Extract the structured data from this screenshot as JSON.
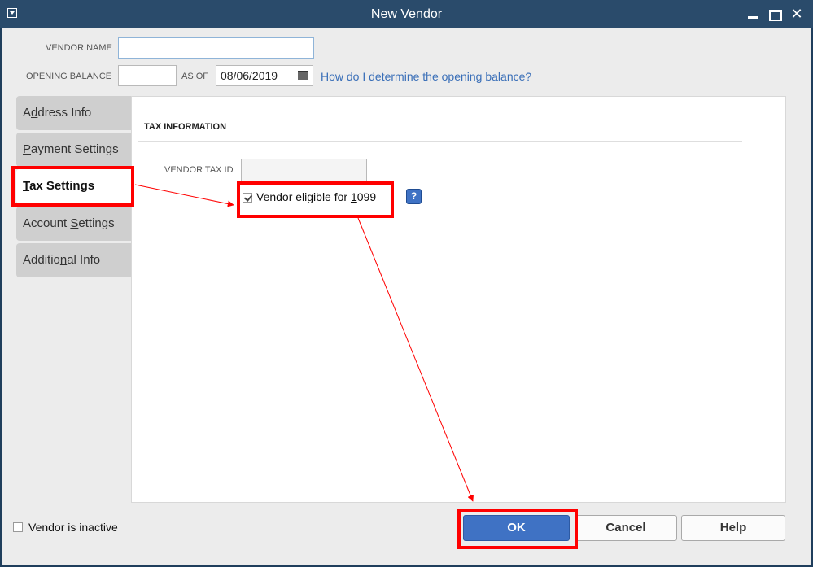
{
  "window": {
    "title": "New Vendor"
  },
  "header": {
    "vendor_name_label": "VENDOR NAME",
    "vendor_name_value": "",
    "opening_balance_label": "OPENING BALANCE",
    "opening_balance_value": "",
    "as_of_label": "AS OF",
    "as_of_date": "08/06/2019",
    "opening_balance_link": "How do I determine the opening balance?"
  },
  "tabs": [
    {
      "label": "Address Info",
      "mnemonic": "d",
      "active": false
    },
    {
      "label": "Payment Settings",
      "mnemonic": "P",
      "active": false
    },
    {
      "label": "Tax Settings",
      "mnemonic": "T",
      "active": true
    },
    {
      "label": "Account Settings",
      "mnemonic": "S",
      "active": false
    },
    {
      "label": "Additional Info",
      "mnemonic": "n",
      "active": false
    }
  ],
  "tax": {
    "section_title": "TAX INFORMATION",
    "vendor_tax_id_label": "VENDOR TAX ID",
    "vendor_tax_id_value": "",
    "eligible_1099_label": "Vendor eligible for 1099",
    "eligible_1099_checked": true
  },
  "footer": {
    "inactive_label": "Vendor is inactive",
    "inactive_checked": false,
    "ok_label": "OK",
    "cancel_label": "Cancel",
    "help_label": "Help"
  },
  "annotation": {
    "highlight_color": "#ff0000"
  }
}
